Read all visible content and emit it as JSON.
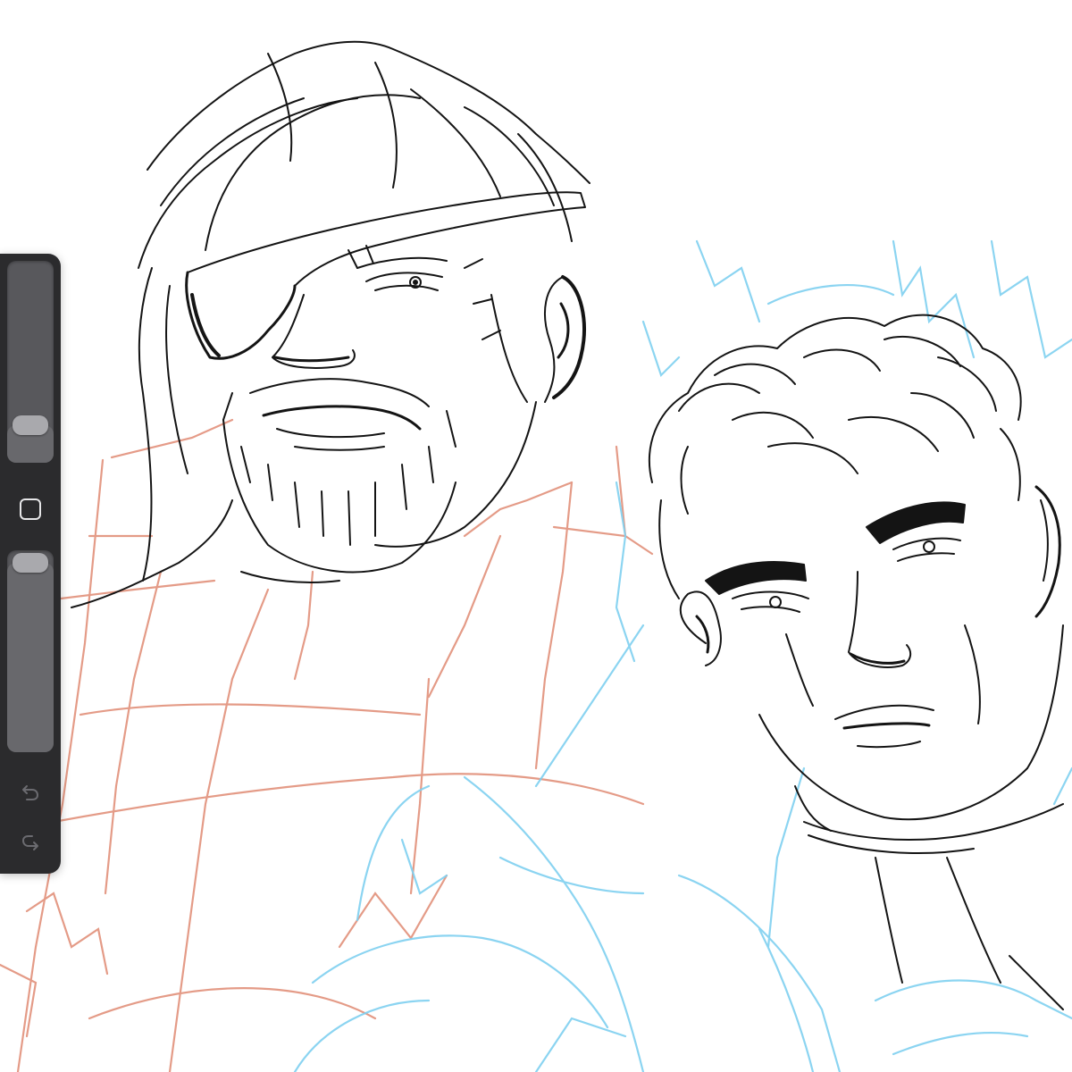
{
  "app": {
    "accent_color": "#2b2b2d",
    "canvas_background": "#ffffff"
  },
  "sidebar": {
    "brush_size_slider": {
      "icon": "slider-thumb",
      "level": 0.14
    },
    "modify_button": {
      "icon": "square-outline-icon"
    },
    "opacity_slider": {
      "icon": "slider-thumb",
      "level": 1.0
    },
    "undo_button": {
      "icon": "undo-arrow-icon"
    },
    "redo_button": {
      "icon": "redo-arrow-icon"
    }
  },
  "artwork": {
    "sketch_colors": {
      "ink": "#141414",
      "red_construction": "#e08a73",
      "blue_construction": "#7fd0f0"
    }
  }
}
